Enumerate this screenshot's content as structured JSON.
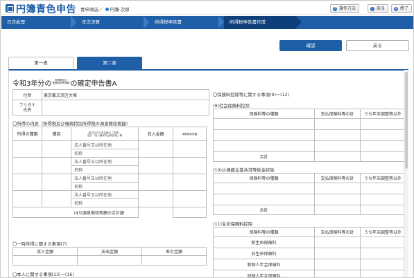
{
  "app": {
    "title": "円簿青色申告",
    "user_office": "青申商店／",
    "user_name": "円簿 次郎"
  },
  "header_buttons": [
    {
      "label": "操作方法",
      "icon": "question-icon"
    },
    {
      "label": "戻る",
      "icon": "back-arrow-icon"
    },
    {
      "label": "終了",
      "icon": "close-icon"
    }
  ],
  "steps": [
    "日次処理",
    "年次決算",
    "所得税申告書",
    "所得税申告書作成"
  ],
  "actions": {
    "confirm": "確認",
    "back": "戻る"
  },
  "tabs": [
    "第一表",
    "第二表"
  ],
  "form": {
    "title_prefix": "令和3年分の",
    "title_small_1": "所得税及び",
    "title_small_2": "復興特別所得税",
    "title_suffix": "の確定申告書A",
    "address_label": "住所",
    "address_value": "東京都文京区大塚",
    "furigana_label": "フリガナ",
    "name_label": "氏名",
    "income_section": "〇所得の内訳（所得税及び復興特別所得税の源泉徴収税額）",
    "income_headers": {
      "type": "所得の種類",
      "item": "種目",
      "payer_1": "給与などの支払者の「名称」",
      "payer_2": "及び「法人番号又は所在地」等",
      "amount": "収入金額",
      "withheld": "源泉徴収税額"
    },
    "corp_label": "法人番号又は所在地",
    "name_field": "名称",
    "total_label": "(43)源泉徴収税額の合計額",
    "temp_section": "〇一時所得に関する事項(7)",
    "temp_headers": [
      "収入金額",
      "支出金額",
      "差引金額"
    ],
    "personal_section": "〇本人に関する事項(13)～(16)",
    "insurance_section": "〇保険料控除等に関する事項(9)～(12)",
    "social_title": "(9)社会保険料控除",
    "social_headers": [
      "保険料等の種類",
      "支払保険料等の計",
      "うち年末調整等以外"
    ],
    "social_total": "合計",
    "small_title": "(10)小規模企業共済等掛金控除",
    "small_headers": [
      "保険料等の種類",
      "支払保険料等の計",
      "うち年末調整等以外"
    ],
    "small_total": "合計",
    "life_title": "(11)生命保険料控除",
    "life_headers": [
      "保険料等の種類",
      "支払保険料等の計",
      "うち年末調整等以外"
    ],
    "life_rows": [
      "新生命保険料",
      "旧生命保険料",
      "新個人年金保険料",
      "旧個人年金保険料"
    ]
  }
}
